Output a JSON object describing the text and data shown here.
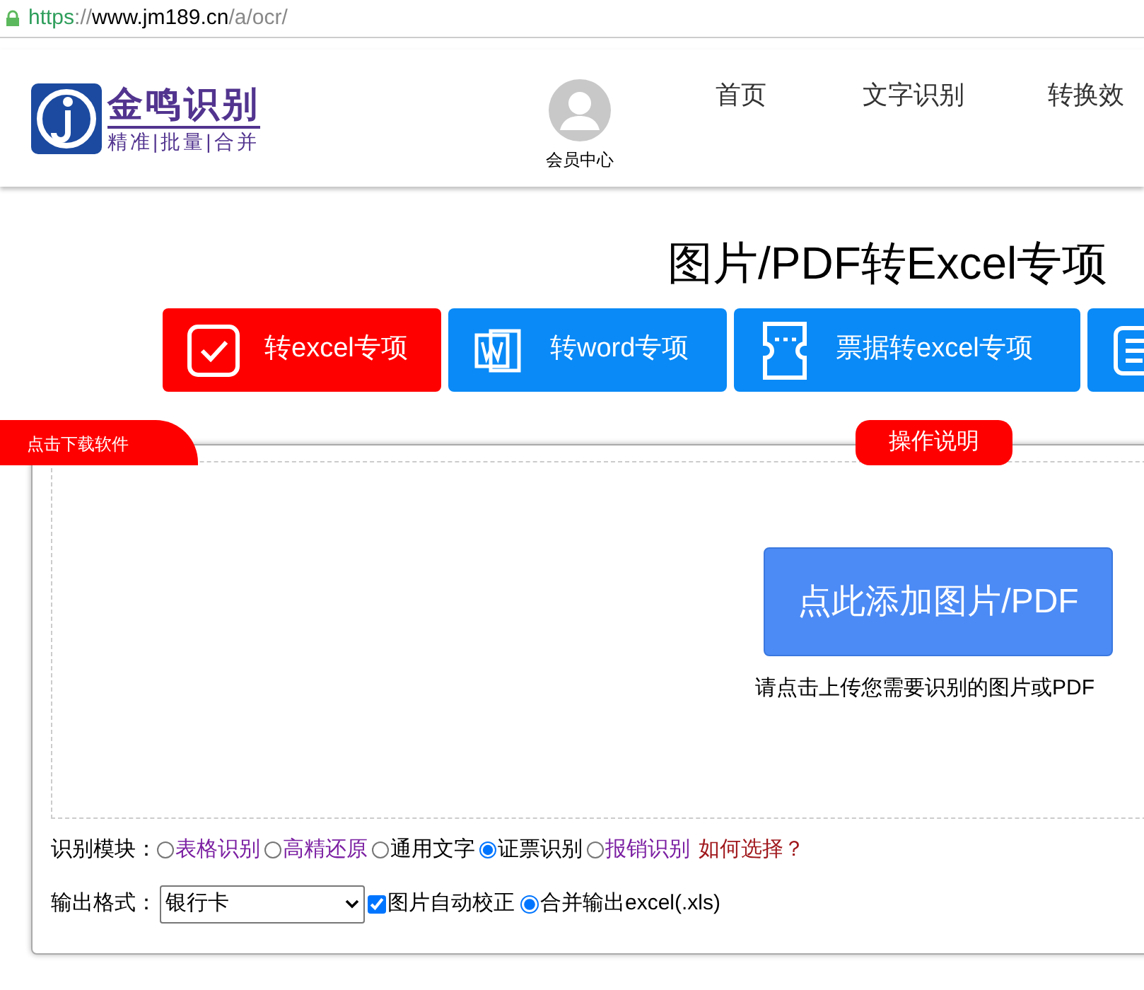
{
  "address_bar": {
    "scheme": "https",
    "separator": "://",
    "host": "www.jm189.cn",
    "path": "/a/ocr/"
  },
  "logo": {
    "name": "金鸣识别",
    "tagline": "精准|批量|合并"
  },
  "header": {
    "member": "会员中心",
    "nav": [
      "首页",
      "文字识别",
      "转换效"
    ]
  },
  "title": "图片/PDF转Excel专项",
  "tabs": [
    {
      "label": "转excel专项",
      "kind": "check",
      "selected": true
    },
    {
      "label": "转word专项",
      "kind": "word",
      "selected": false
    },
    {
      "label": "票据转excel专项",
      "kind": "ticket",
      "selected": false
    },
    {
      "kind": "list",
      "selected": false
    }
  ],
  "download_tab": "点击下载软件",
  "help_tab": "操作说明",
  "upload": {
    "button": "点此添加图片/PDF",
    "hint": "请点击上传您需要识别的图片或PDF"
  },
  "module": {
    "label": "识别模块：",
    "options": [
      {
        "label": "表格识别",
        "link": true,
        "selected": false
      },
      {
        "label": "高精还原",
        "link": true,
        "selected": false
      },
      {
        "label": "通用文字",
        "link": false,
        "selected": false
      },
      {
        "label": "证票识别",
        "link": false,
        "selected": true
      },
      {
        "label": "报销识别",
        "link": true,
        "selected": false
      }
    ],
    "help": "如何选择？"
  },
  "output": {
    "label": "输出格式：",
    "value": "银行卡",
    "autocorrect": {
      "label": "图片自动校正",
      "checked": true
    },
    "merge": {
      "label": "合并输出excel(.xls)",
      "selected": true
    }
  }
}
